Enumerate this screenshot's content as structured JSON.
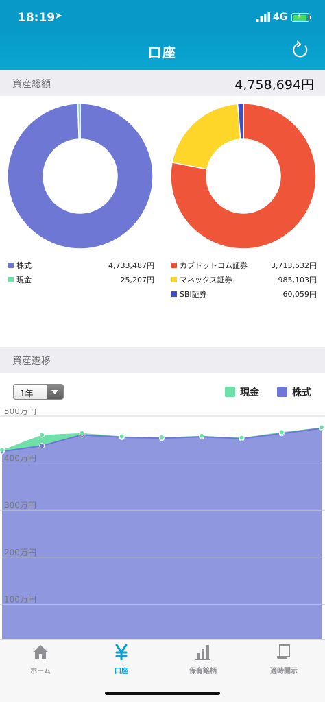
{
  "status": {
    "time": "18:19",
    "network": "4G"
  },
  "nav": {
    "title": "口座"
  },
  "summary": {
    "header": "資産総額",
    "total": "4,758,694円"
  },
  "allocation_legend": [
    {
      "name": "株式",
      "value": "4,733,487円",
      "color": "#6e78d4"
    },
    {
      "name": "現金",
      "value": "25,207円",
      "color": "#6fe0a8"
    }
  ],
  "broker_legend": [
    {
      "name": "カブドットコム証券",
      "value": "3,713,532円",
      "color": "#ef5538"
    },
    {
      "name": "マネックス証券",
      "value": "985,103円",
      "color": "#fdd629"
    },
    {
      "name": "SBI証券",
      "value": "60,059円",
      "color": "#3d4ec4"
    }
  ],
  "history": {
    "header": "資産遷移",
    "period": "1年",
    "legend_cash": "現金",
    "legend_stock": "株式",
    "cash_color": "#6fe0a8",
    "stock_color": "#6e78d4"
  },
  "chart_data": [
    {
      "type": "pie",
      "categories": [
        "株式",
        "現金"
      ],
      "values": [
        4733487,
        25207
      ],
      "colors": [
        "#6e78d4",
        "#6fe0a8"
      ]
    },
    {
      "type": "pie",
      "categories": [
        "カブドットコム証券",
        "マネックス証券",
        "SBI証券"
      ],
      "values": [
        3713532,
        985103,
        60059
      ],
      "colors": [
        "#ef5538",
        "#fdd629",
        "#3d4ec4"
      ]
    },
    {
      "type": "area",
      "stacked": true,
      "x": [
        0,
        1,
        2,
        3,
        4,
        5,
        6,
        7,
        8
      ],
      "series": [
        {
          "name": "株式",
          "values": [
            425,
            437,
            460,
            455,
            453,
            456,
            452,
            463,
            474
          ]
        },
        {
          "name": "現金",
          "values": [
            3,
            23,
            4,
            2,
            2,
            2,
            2,
            3,
            2
          ]
        }
      ],
      "yticks": [
        "100万円",
        "200万円",
        "300万円",
        "400万円",
        "500万円"
      ],
      "ylim": [
        0,
        500
      ],
      "grid": true,
      "legend": "top-right"
    }
  ],
  "tabs": [
    {
      "label": "ホーム",
      "icon": "home-icon",
      "active": false
    },
    {
      "label": "口座",
      "icon": "yen-icon",
      "active": true
    },
    {
      "label": "保有銘柄",
      "icon": "bar-chart-icon",
      "active": false
    },
    {
      "label": "適時開示",
      "icon": "document-icon",
      "active": false
    }
  ]
}
